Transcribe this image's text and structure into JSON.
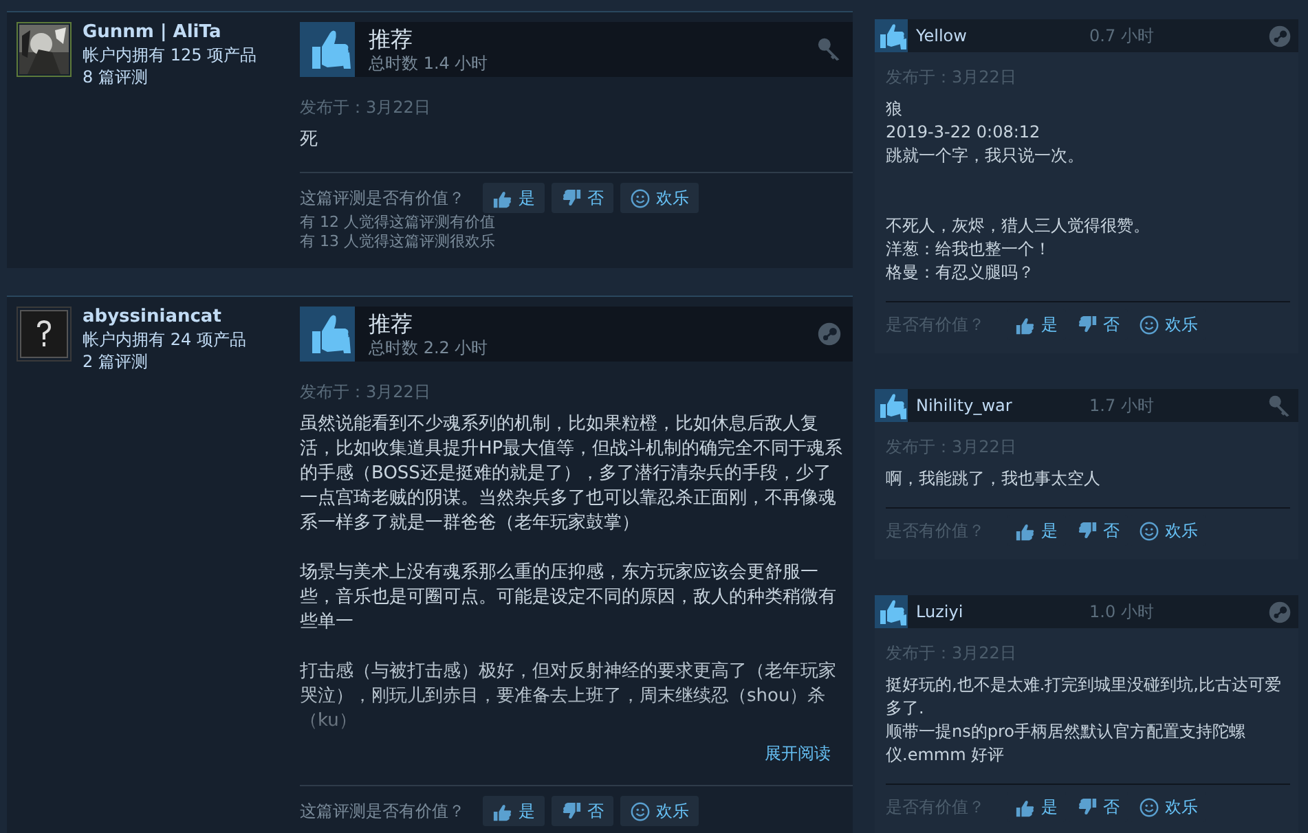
{
  "main_reviews": [
    {
      "author": {
        "name": "Gunnm | AliTa",
        "products": "帐户内拥有 125 项产品",
        "reviews": "8 篇评测"
      },
      "recommended": true,
      "verdict": "推荐",
      "hours": "总时数 1.4 小时",
      "source": {
        "kind": "key"
      },
      "posted": "发布于：3月22日",
      "paragraphs": [
        [
          "死"
        ]
      ],
      "faded": false,
      "helpful_prompt": "这篇评测是否有价值？",
      "votes": [
        {
          "kind": "yes",
          "label": "是"
        },
        {
          "kind": "no",
          "label": "否"
        },
        {
          "kind": "funny",
          "label": "欢乐"
        }
      ],
      "stats": [
        "有 12 人觉得这篇评测有价值",
        "有 13 人觉得这篇评测很欢乐"
      ]
    },
    {
      "author": {
        "name": "abyssiniancat",
        "avatar": {
          "kind": "unknown"
        },
        "products": "帐户内拥有 24 项产品",
        "reviews": "2 篇评测"
      },
      "recommended": true,
      "verdict": "推荐",
      "hours": "总时数 2.2 小时",
      "source": {
        "kind": "steam"
      },
      "posted": "发布于：3月22日",
      "paragraphs": [
        [
          "虽然说能看到不少魂系列的机制，比如果粒橙，比如休息后敌人复活，比如收集道具提升HP最大值等，但战斗机制的确完全不同于魂系的手感（BOSS还是挺难的就是了），多了潜行清杂兵的手段，少了一点宫琦老贼的阴谋。当然杂兵多了也可以靠忍杀正面刚，不再像魂系一样多了就是一群爸爸（老年玩家鼓掌）"
        ],
        [
          "场景与美术上没有魂系那么重的压抑感，东方玩家应该会更舒服一些，音乐也是可圈可点。可能是设定不同的原因，敌人的种类稍微有些单一"
        ],
        [
          "打击感（与被打击感）极好，但对反射神经的要求更高了（老年玩家哭泣），刚玩儿到赤目，要准备去上班了，周末继续忍（shou）杀（ku）"
        ]
      ],
      "faded": true,
      "read_more": "展开阅读",
      "helpful_prompt": "这篇评测是否有价值？",
      "votes": [
        {
          "kind": "yes",
          "label": "是"
        },
        {
          "kind": "no",
          "label": "否"
        },
        {
          "kind": "funny",
          "label": "欢乐"
        }
      ]
    }
  ],
  "side_reviews": [
    {
      "author": "Yellow",
      "recommended": true,
      "hours": "0.7 小时",
      "source": {
        "kind": "steam"
      },
      "posted": "发布于：3月22日",
      "paragraphs": [
        [
          "狼",
          "2019-3-22 0:08:12",
          "跳就一个字，我只说一次。"
        ],
        [
          "不死人，灰烬，猎人三人觉得很赞。",
          "洋葱：给我也整一个！",
          "格曼：有忍义腿吗？"
        ]
      ],
      "helpful_prompt": "是否有价值？",
      "votes": [
        {
          "kind": "yes",
          "label": "是"
        },
        {
          "kind": "no",
          "label": "否"
        },
        {
          "kind": "funny",
          "label": "欢乐"
        }
      ]
    },
    {
      "author": "Nihility_war",
      "recommended": true,
      "hours": "1.7 小时",
      "source": {
        "kind": "key"
      },
      "posted": "发布于：3月22日",
      "paragraphs": [
        [
          "啊，我能跳了，我也事太空人"
        ]
      ],
      "helpful_prompt": "是否有价值？",
      "votes": [
        {
          "kind": "yes",
          "label": "是"
        },
        {
          "kind": "no",
          "label": "否"
        },
        {
          "kind": "funny",
          "label": "欢乐"
        }
      ]
    },
    {
      "author": "Luziyi",
      "recommended": true,
      "hours": "1.0 小时",
      "source": {
        "kind": "steam"
      },
      "posted": "发布于：3月22日",
      "paragraphs": [
        [
          "挺好玩的,也不是太难.打完到城里没碰到坑,比古达可爱多了.",
          "顺带一提ns的pro手柄居然默认官方配置支持陀螺仪.emmm 好评"
        ]
      ],
      "helpful_prompt": "是否有价值？",
      "votes": [
        {
          "kind": "yes",
          "label": "是"
        },
        {
          "kind": "no",
          "label": "否"
        },
        {
          "kind": "funny",
          "label": "欢乐"
        }
      ]
    }
  ]
}
